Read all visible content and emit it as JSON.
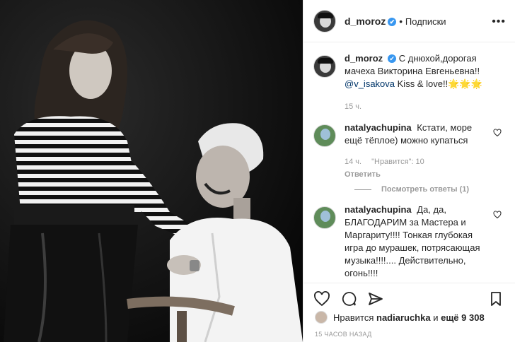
{
  "header": {
    "username": "d_moroz",
    "verified_glyph": "✔",
    "separator": "•",
    "follow_label": "Подписки",
    "more_icon": "more-horizontal-icon"
  },
  "caption": {
    "username": "d_moroz",
    "verified_glyph": "✔",
    "text": "С днюхой,дорогая мачеха Викторина Евгеньевна!!",
    "mention": "@v_isakova",
    "text_after": "Kiss & love!!🌟🌟🌟",
    "time": "15 ч."
  },
  "comments": [
    {
      "username": "natalyachupina",
      "text": "Кстати, море ещё тёплое) можно купаться",
      "time": "14 ч.",
      "likes": "\"Нравится\": 10",
      "reply_label": "Ответить",
      "view_replies": "Посмотреть ответы (1)"
    },
    {
      "username": "natalyachupina",
      "text": "Да, да, БЛАГОДАРИМ за Мастера и Маргариту!!!! Тонкая глубокая игра до мурашек, потрясающая музыка!!!!.... Действительно, огонь!!!!"
    }
  ],
  "likes": {
    "prefix": "Нравится",
    "user": "nadiaruchka",
    "middle": "и",
    "others": "ещё 9 308"
  },
  "timeago": "15 ЧАСОВ НАЗАД",
  "colors": {
    "link": "#003569",
    "verified": "#3897f0",
    "muted": "#999999"
  }
}
